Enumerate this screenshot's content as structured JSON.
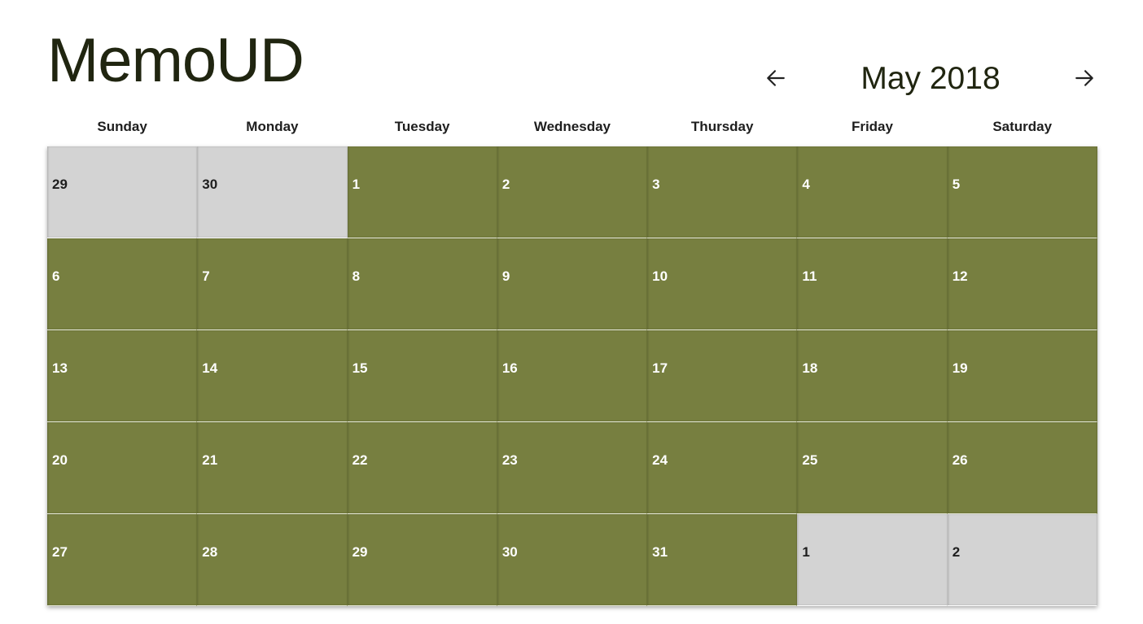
{
  "app": {
    "title": "MemoUD"
  },
  "nav": {
    "month_label": "May 2018",
    "prev_icon": "arrow-left-icon",
    "next_icon": "arrow-right-icon"
  },
  "colors": {
    "in_month": "#777f40",
    "out_of_month": "#d3d3d3",
    "title_text": "#202510"
  },
  "weekdays": [
    "Sunday",
    "Monday",
    "Tuesday",
    "Wednesday",
    "Thursday",
    "Friday",
    "Saturday"
  ],
  "days": [
    {
      "label": "29",
      "in_month": false
    },
    {
      "label": "30",
      "in_month": false
    },
    {
      "label": "1",
      "in_month": true
    },
    {
      "label": "2",
      "in_month": true
    },
    {
      "label": "3",
      "in_month": true
    },
    {
      "label": "4",
      "in_month": true
    },
    {
      "label": "5",
      "in_month": true
    },
    {
      "label": "6",
      "in_month": true
    },
    {
      "label": "7",
      "in_month": true
    },
    {
      "label": "8",
      "in_month": true
    },
    {
      "label": "9",
      "in_month": true
    },
    {
      "label": "10",
      "in_month": true
    },
    {
      "label": "11",
      "in_month": true
    },
    {
      "label": "12",
      "in_month": true
    },
    {
      "label": "13",
      "in_month": true
    },
    {
      "label": "14",
      "in_month": true
    },
    {
      "label": "15",
      "in_month": true
    },
    {
      "label": "16",
      "in_month": true
    },
    {
      "label": "17",
      "in_month": true
    },
    {
      "label": "18",
      "in_month": true
    },
    {
      "label": "19",
      "in_month": true
    },
    {
      "label": "20",
      "in_month": true
    },
    {
      "label": "21",
      "in_month": true
    },
    {
      "label": "22",
      "in_month": true
    },
    {
      "label": "23",
      "in_month": true
    },
    {
      "label": "24",
      "in_month": true
    },
    {
      "label": "25",
      "in_month": true
    },
    {
      "label": "26",
      "in_month": true
    },
    {
      "label": "27",
      "in_month": true
    },
    {
      "label": "28",
      "in_month": true
    },
    {
      "label": "29",
      "in_month": true
    },
    {
      "label": "30",
      "in_month": true
    },
    {
      "label": "31",
      "in_month": true
    },
    {
      "label": "1",
      "in_month": false
    },
    {
      "label": "2",
      "in_month": false
    }
  ]
}
